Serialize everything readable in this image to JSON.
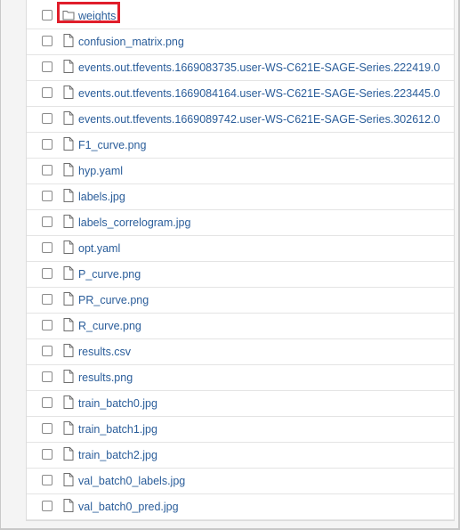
{
  "files": [
    {
      "name": "weights",
      "type": "folder",
      "icon": "folder-icon",
      "highlighted": true
    },
    {
      "name": "confusion_matrix.png",
      "type": "file",
      "icon": "file-icon"
    },
    {
      "name": "events.out.tfevents.1669083735.user-WS-C621E-SAGE-Series.222419.0",
      "type": "file",
      "icon": "file-icon"
    },
    {
      "name": "events.out.tfevents.1669084164.user-WS-C621E-SAGE-Series.223445.0",
      "type": "file",
      "icon": "file-icon"
    },
    {
      "name": "events.out.tfevents.1669089742.user-WS-C621E-SAGE-Series.302612.0",
      "type": "file",
      "icon": "file-icon"
    },
    {
      "name": "F1_curve.png",
      "type": "file",
      "icon": "file-icon"
    },
    {
      "name": "hyp.yaml",
      "type": "file",
      "icon": "file-icon"
    },
    {
      "name": "labels.jpg",
      "type": "file",
      "icon": "file-icon"
    },
    {
      "name": "labels_correlogram.jpg",
      "type": "file",
      "icon": "file-icon"
    },
    {
      "name": "opt.yaml",
      "type": "file",
      "icon": "file-icon"
    },
    {
      "name": "P_curve.png",
      "type": "file",
      "icon": "file-icon"
    },
    {
      "name": "PR_curve.png",
      "type": "file",
      "icon": "file-icon"
    },
    {
      "name": "R_curve.png",
      "type": "file",
      "icon": "file-icon"
    },
    {
      "name": "results.csv",
      "type": "file",
      "icon": "file-icon"
    },
    {
      "name": "results.png",
      "type": "file",
      "icon": "file-icon"
    },
    {
      "name": "train_batch0.jpg",
      "type": "file",
      "icon": "file-icon"
    },
    {
      "name": "train_batch1.jpg",
      "type": "file",
      "icon": "file-icon"
    },
    {
      "name": "train_batch2.jpg",
      "type": "file",
      "icon": "file-icon"
    },
    {
      "name": "val_batch0_labels.jpg",
      "type": "file",
      "icon": "file-icon"
    },
    {
      "name": "val_batch0_pred.jpg",
      "type": "file",
      "icon": "file-icon"
    }
  ],
  "colors": {
    "link": "#2a5d9a",
    "highlight_border": "#e01e2b"
  }
}
